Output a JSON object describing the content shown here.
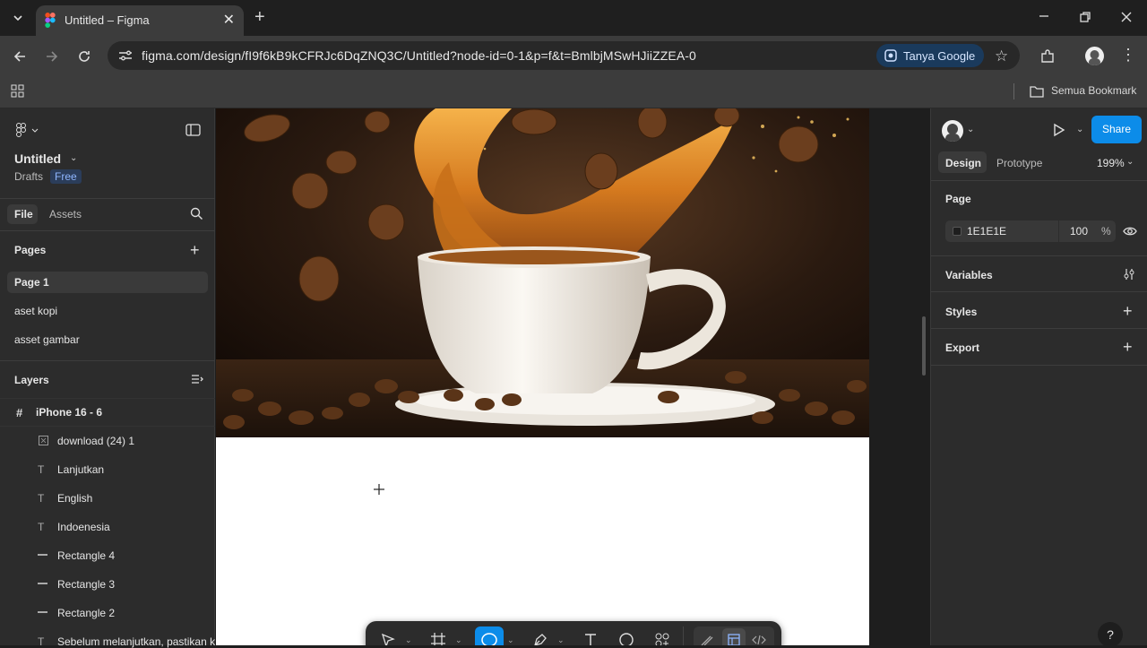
{
  "browser": {
    "tab_title": "Untitled – Figma",
    "url": "figma.com/design/fI9f6kB9kCFRJc6DqZNQ3C/Untitled?node-id=0-1&p=f&t=BmlbjMSwHJiiZZEA-0",
    "tanya_google": "Tanya Google",
    "bookmarks_label": "Semua Bookmark"
  },
  "file": {
    "name": "Untitled",
    "location": "Drafts",
    "plan_badge": "Free"
  },
  "left_tabs": {
    "file": "File",
    "assets": "Assets"
  },
  "pages": {
    "header": "Pages",
    "items": [
      "Page 1",
      "aset kopi",
      "asset gambar"
    ]
  },
  "layers": {
    "header": "Layers",
    "frame": "iPhone 16 - 6",
    "items": [
      {
        "name": "download (24) 1",
        "kind": "image"
      },
      {
        "name": "Lanjutkan",
        "kind": "text"
      },
      {
        "name": "English",
        "kind": "text"
      },
      {
        "name": "Indoenesia",
        "kind": "text"
      },
      {
        "name": "Rectangle 4",
        "kind": "rect"
      },
      {
        "name": "Rectangle 3",
        "kind": "rect"
      },
      {
        "name": "Rectangle 2",
        "kind": "rect"
      },
      {
        "name": "Sebelum melanjutkan, pastikan ka",
        "kind": "text"
      }
    ]
  },
  "right": {
    "tabs": {
      "design": "Design",
      "prototype": "Prototype"
    },
    "zoom": "199%",
    "share": "Share",
    "page_section": "Page",
    "page_fill_hex": "1E1E1E",
    "page_fill_opacity": "100",
    "percent_sign": "%",
    "variables": "Variables",
    "styles": "Styles",
    "export": "Export",
    "help": "?"
  },
  "colors": {
    "accent": "#0c8ce9",
    "canvas_bg": "#1e1e1e",
    "panel_bg": "#2c2c2c"
  }
}
